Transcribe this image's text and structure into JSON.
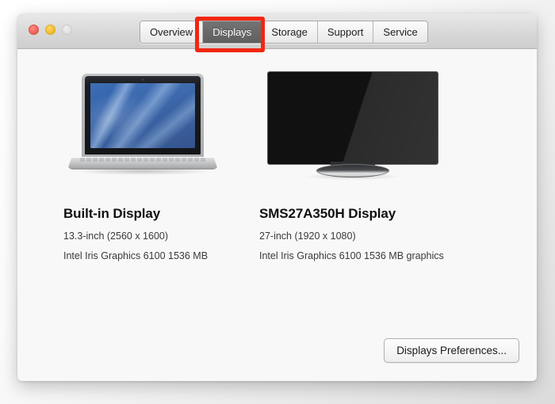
{
  "window": {
    "controls": {
      "close_label": "Close",
      "minimize_label": "Minimize",
      "zoom_label": "Zoom"
    }
  },
  "toolbar": {
    "tabs": [
      {
        "label": "Overview",
        "selected": false
      },
      {
        "label": "Displays",
        "selected": true
      },
      {
        "label": "Storage",
        "selected": false
      },
      {
        "label": "Support",
        "selected": false
      },
      {
        "label": "Service",
        "selected": false
      }
    ]
  },
  "annotation": {
    "target_tab": "Displays",
    "color": "#f22613"
  },
  "main": {
    "displays": [
      {
        "artwork": "macbook-laptop",
        "title": "Built-in Display",
        "size_line": "13.3-inch (2560 x 1600)",
        "graphics_line": "Intel Iris Graphics 6100 1536 MB"
      },
      {
        "artwork": "external-monitor",
        "title": "SMS27A350H Display",
        "size_line": "27-inch (1920 x 1080)",
        "graphics_line": "Intel Iris Graphics 6100 1536 MB graphics"
      }
    ],
    "preferences_button": "Displays Preferences..."
  }
}
